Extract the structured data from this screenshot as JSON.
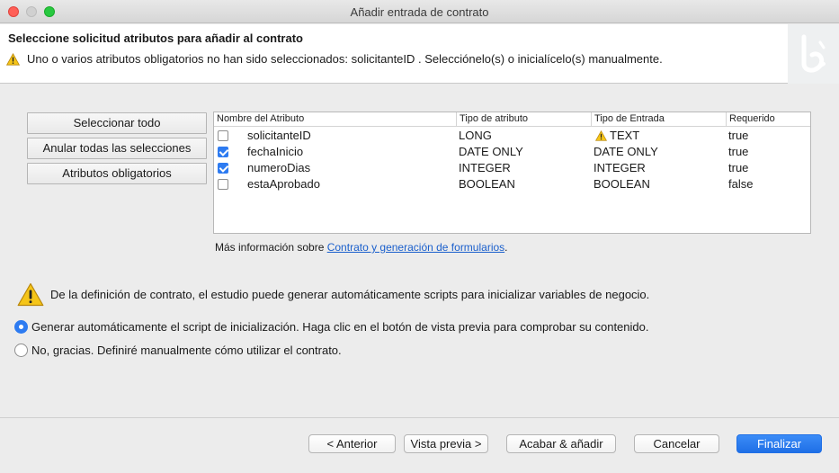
{
  "window": {
    "title": "Añadir entrada de contrato"
  },
  "header": {
    "title": "Seleccione solicitud atributos para añadir al contrato",
    "warning": "Uno o varios atributos obligatorios no han sido seleccionados: solicitanteID . Selecciónelo(s) o inicialícelo(s) manualmente."
  },
  "side_buttons": {
    "select_all": "Seleccionar todo",
    "deselect_all": "Anular todas las selecciones",
    "mandatory": "Atributos obligatorios"
  },
  "table": {
    "columns": [
      "Nombre del Atributo",
      "Tipo de atributo",
      "Tipo de Entrada",
      "Requerido"
    ],
    "rows": [
      {
        "checked": false,
        "name": "solicitanteID",
        "type": "LONG",
        "input": "TEXT",
        "input_warning": true,
        "required": "true"
      },
      {
        "checked": true,
        "name": "fechaInicio",
        "type": "DATE ONLY",
        "input": "DATE ONLY",
        "input_warning": false,
        "required": "true"
      },
      {
        "checked": true,
        "name": "numeroDias",
        "type": "INTEGER",
        "input": "INTEGER",
        "input_warning": false,
        "required": "true"
      },
      {
        "checked": false,
        "name": "estaAprobado",
        "type": "BOOLEAN",
        "input": "BOOLEAN",
        "input_warning": false,
        "required": "false"
      }
    ]
  },
  "info": {
    "prefix": "Más información sobre ",
    "link": "Contrato y generación de formularios",
    "suffix": "."
  },
  "contract": {
    "message": "De la definición de contrato, el estudio puede generar automáticamente scripts para inicializar variables de negocio.",
    "options": [
      {
        "label": "Generar automáticamente el script de inicialización. Haga clic en el botón de vista previa para comprobar su contenido.",
        "selected": true
      },
      {
        "label": "No, gracias. Definiré manualmente cómo utilizar el contrato.",
        "selected": false
      }
    ]
  },
  "footer": {
    "back": "< Anterior",
    "preview": "Vista previa >",
    "finish_add": "Acabar & añadir",
    "cancel": "Cancelar",
    "finalize": "Finalizar"
  },
  "colors": {
    "accent": "#2d7bf1",
    "warning": "#f5c518",
    "link": "#1a5fcc"
  },
  "icons": {
    "warning": "warning-icon",
    "logo": "bonita-logo"
  }
}
